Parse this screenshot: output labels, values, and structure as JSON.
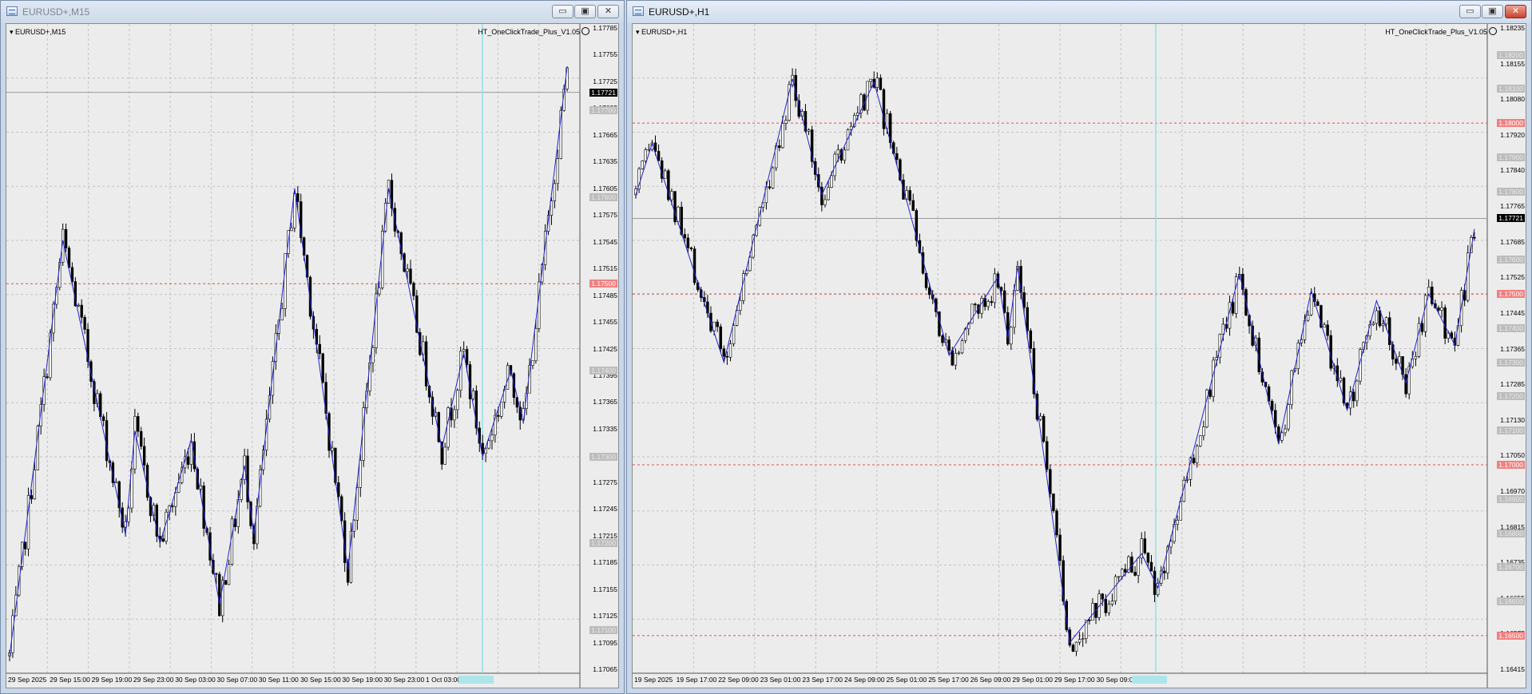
{
  "windows": [
    {
      "id": "m15",
      "title": "EURUSD+,M15",
      "active": false,
      "symbol_label": "EURUSD+,M15",
      "ea_label": "HT_OneClickTrade_Plus_V1.05",
      "price_labels": [
        "1.17785",
        "1.17755",
        "1.17725",
        "1.17695",
        "1.17665",
        "1.17635",
        "1.17605",
        "1.17575",
        "1.17545",
        "1.17515",
        "1.17485",
        "1.17455",
        "1.17425",
        "1.17395",
        "1.17365",
        "1.17335",
        "1.17305",
        "1.17275",
        "1.17245",
        "1.17215",
        "1.17185",
        "1.17155",
        "1.17125",
        "1.17095",
        "1.17065"
      ],
      "gray_boxes": [
        "1.17700",
        "1.17600",
        "1.17400",
        "1.17300",
        "1.17200",
        "1.17100"
      ],
      "current_price": "1.17721",
      "level_red": "1.17500",
      "time_labels": [
        "29 Sep 2025",
        "29 Sep 15:00",
        "29 Sep 19:00",
        "29 Sep 23:00",
        "30 Sep 03:00",
        "30 Sep 07:00",
        "30 Sep 11:00",
        "30 Sep 15:00",
        "30 Sep 19:00",
        "30 Sep 23:00",
        "1 Oct 03:00"
      ],
      "time_highlight": "1 Oct 06:00",
      "chart_data": {
        "type": "candlestick",
        "ylim": [
          1.1705,
          1.178
        ],
        "zigzag": [
          [
            0,
            1.1707
          ],
          [
            17,
            1.1755
          ],
          [
            37,
            1.1721
          ],
          [
            40,
            1.1733
          ],
          [
            48,
            1.172
          ],
          [
            58,
            1.1732
          ],
          [
            67,
            1.1713
          ],
          [
            75,
            1.1729
          ],
          [
            78,
            1.1721
          ],
          [
            91,
            1.1761
          ],
          [
            108,
            1.1717
          ],
          [
            121,
            1.1761
          ],
          [
            138,
            1.1731
          ],
          [
            145,
            1.1742
          ],
          [
            151,
            1.173
          ],
          [
            160,
            1.174
          ],
          [
            164,
            1.1734
          ],
          [
            178,
            1.1775
          ]
        ]
      }
    },
    {
      "id": "h1",
      "title": "EURUSD+,H1",
      "active": true,
      "symbol_label": "EURUSD+,H1",
      "ea_label": "HT_OneClickTrade_Plus_V1.05",
      "price_labels": [
        "1.18235",
        "1.18155",
        "1.18080",
        "1.17920",
        "1.17840",
        "1.17765",
        "1.17685",
        "1.17525",
        "1.17445",
        "1.17365",
        "1.17285",
        "1.17130",
        "1.17050",
        "1.16970",
        "1.16815",
        "1.16735",
        "1.16655",
        "1.16575",
        "1.16415"
      ],
      "gray_boxes": [
        "1.18200",
        "1.18100",
        "1.17900",
        "1.17800",
        "1.17600",
        "1.17400",
        "1.17300",
        "1.17200",
        "1.17100",
        "1.16900",
        "1.16800",
        "1.16700",
        "1.16600"
      ],
      "red_boxes": [
        "1.18000",
        "1.17500",
        "1.17000",
        "1.16500"
      ],
      "current_price": "1.17721",
      "time_labels": [
        "19 Sep 2025",
        "19 Sep 17:00",
        "22 Sep 09:00",
        "23 Sep 01:00",
        "23 Sep 17:00",
        "24 Sep 09:00",
        "25 Sep 01:00",
        "25 Sep 17:00",
        "26 Sep 09:00",
        "29 Sep 01:00",
        "29 Sep 17:00",
        "30 Sep 09:00"
      ],
      "time_highlight": "1 Oct 01:00",
      "chart_data": {
        "type": "candlestick",
        "ylim": [
          1.1639,
          1.1829
        ],
        "zigzag": [
          [
            0,
            1.1779
          ],
          [
            5,
            1.1794
          ],
          [
            27,
            1.173
          ],
          [
            48,
            1.1813
          ],
          [
            57,
            1.1779
          ],
          [
            73,
            1.1812
          ],
          [
            96,
            1.1732
          ],
          [
            111,
            1.1755
          ],
          [
            114,
            1.1737
          ],
          [
            117,
            1.1758
          ],
          [
            133,
            1.1648
          ],
          [
            155,
            1.1674
          ],
          [
            160,
            1.1664
          ],
          [
            185,
            1.1756
          ],
          [
            197,
            1.1706
          ],
          [
            207,
            1.1751
          ],
          [
            218,
            1.1716
          ],
          [
            227,
            1.1748
          ],
          [
            236,
            1.1724
          ],
          [
            243,
            1.175
          ],
          [
            251,
            1.1735
          ],
          [
            257,
            1.1769
          ]
        ]
      }
    }
  ]
}
